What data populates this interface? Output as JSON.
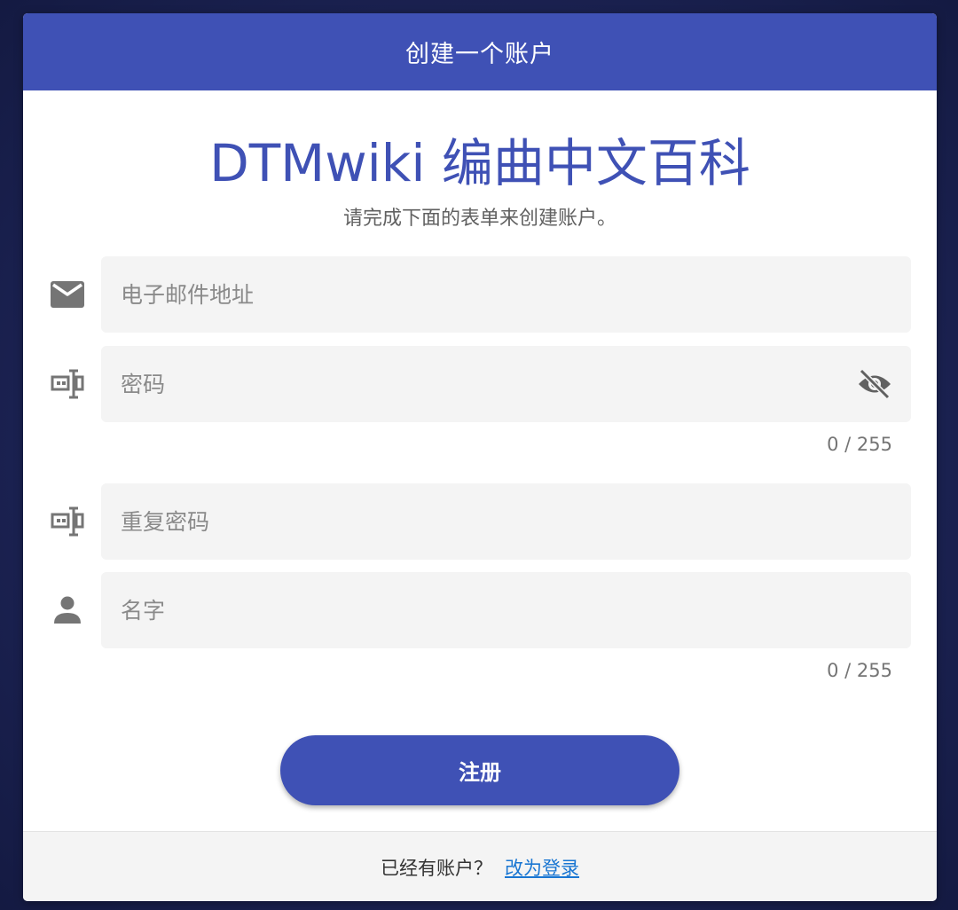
{
  "header": {
    "title": "创建一个账户"
  },
  "brand": {
    "title": "DTMwiki 编曲中文百科",
    "subtitle": "请完成下面的表单来创建账户。"
  },
  "fields": {
    "email": {
      "placeholder": "电子邮件地址",
      "icon": "mail-icon"
    },
    "password": {
      "placeholder": "密码",
      "icon": "password-icon",
      "toggle_icon": "eye-off-icon",
      "counter": "0 / 255"
    },
    "repeat_password": {
      "placeholder": "重复密码",
      "icon": "password-icon"
    },
    "name": {
      "placeholder": "名字",
      "icon": "person-icon",
      "counter": "0 / 255"
    }
  },
  "actions": {
    "register_label": "注册"
  },
  "footer": {
    "prompt": "已经有账户？",
    "login_link": "改为登录"
  },
  "colors": {
    "primary": "#3f51b5",
    "link": "#1976d2",
    "field_bg": "#f4f4f4",
    "icon": "#757575"
  }
}
